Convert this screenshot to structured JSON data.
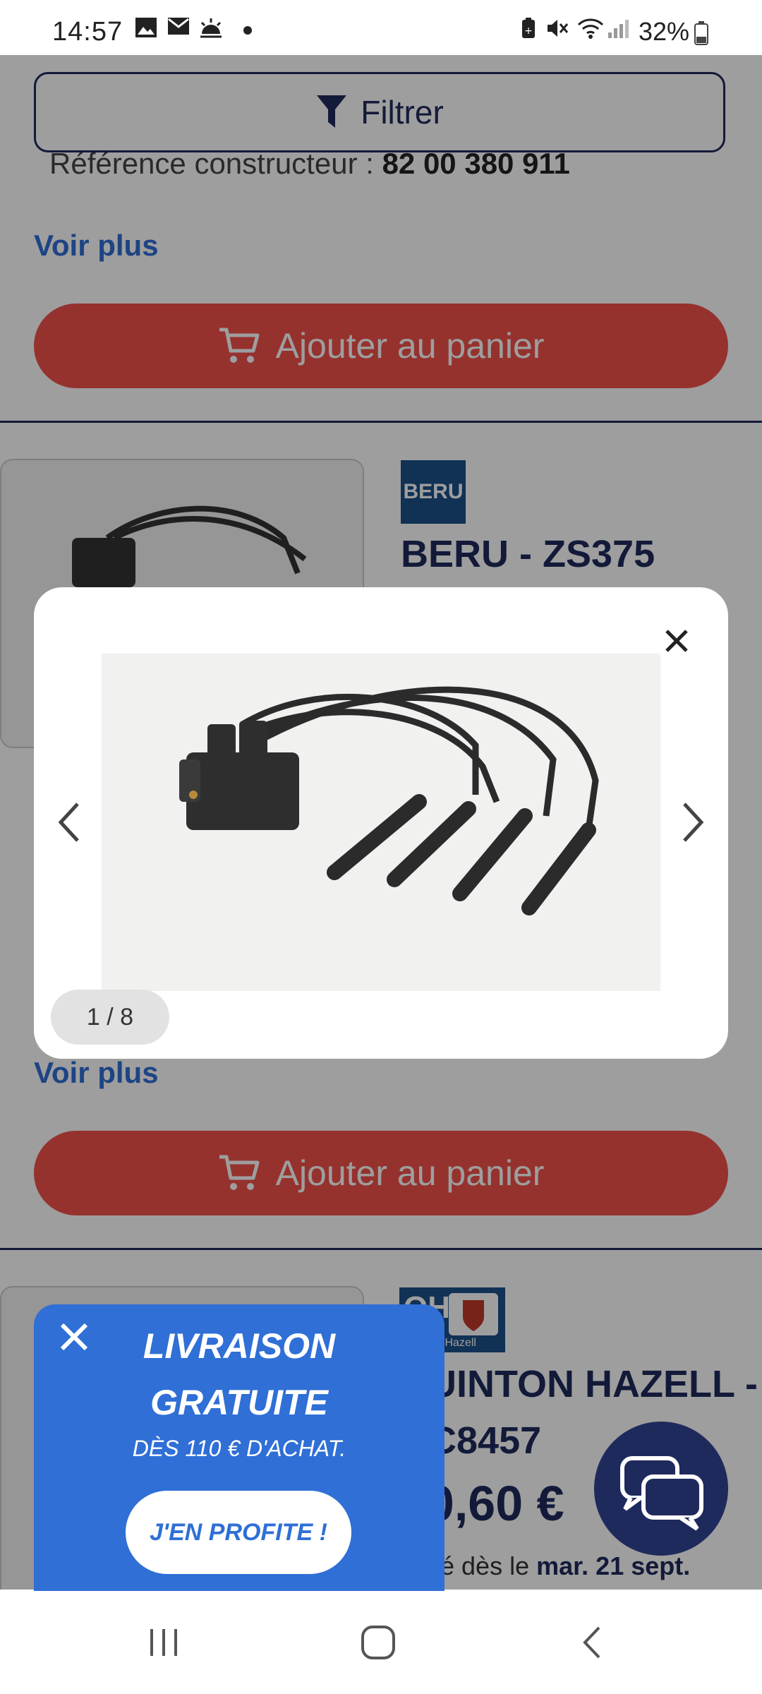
{
  "status_bar": {
    "time": "14:57",
    "battery": "32%",
    "icons": [
      "image-icon",
      "mail-icon",
      "weather-icon",
      "dot-icon",
      "battery-saver-icon",
      "mute-icon",
      "wifi-icon",
      "signal-icon"
    ]
  },
  "page": {
    "filter_label": "Filtrer",
    "reference_label": "Référence constructeur :",
    "reference_value": "82 00 380 911",
    "voir_plus": "Voir plus",
    "add_to_cart": "Ajouter au panier",
    "product2": {
      "brand_logo_text": "BERU",
      "title": "BERU - ZS375"
    },
    "product3": {
      "brand_logo_text": "QH",
      "brand_logo_sub": "Quinton Hazell",
      "title_line1": "QUINTON HAZELL -",
      "title_line2": "QC8457",
      "price": "40,60 €",
      "delivery_prefix": "Livré dès le",
      "delivery_date": "mar. 21 sept."
    }
  },
  "gallery": {
    "counter": "1 / 8"
  },
  "promo": {
    "line1": "LIVRAISON",
    "line2": "GRATUITE",
    "subtitle": "DÈS 110 € D'ACHAT.",
    "cta": "J'EN PROFITE !"
  },
  "colors": {
    "primary_navy": "#1f2a5c",
    "cart_red": "#f0524b",
    "link_blue": "#2f6fd6"
  }
}
